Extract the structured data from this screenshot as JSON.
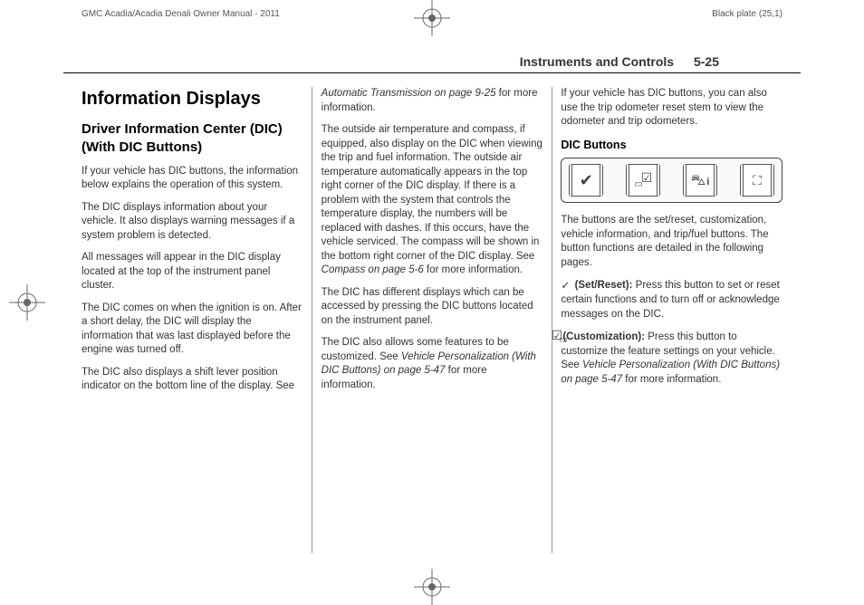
{
  "meta": {
    "manual_title": "GMC Acadia/Acadia Denali Owner Manual - 2011",
    "plate": "Black plate (25,1)"
  },
  "header": {
    "section": "Instruments and Controls",
    "page": "5-25"
  },
  "body": {
    "h1": "Information Displays",
    "h2": "Driver Information Center (DIC) (With DIC Buttons)",
    "p1": "If your vehicle has DIC buttons, the information below explains the operation of this system.",
    "p2": "The DIC displays information about your vehicle. It also displays warning messages if a system problem is detected.",
    "p3": "All messages will appear in the DIC display located at the top of the instrument panel cluster.",
    "p4": "The DIC comes on when the ignition is on. After a short delay, the DIC will display the information that was last displayed before the engine was turned off.",
    "p5a": "The DIC also displays a shift lever position indicator on the bottom line of the display. See ",
    "p5b": "Automatic Transmission on page 9-25",
    "p5c": " for more information.",
    "p6a": "The outside air temperature and compass, if equipped, also display on the DIC when viewing the trip and fuel information. The outside air temperature automatically appears in the top right corner of the DIC display. If there is a problem with the system that controls the temperature display, the numbers will be replaced with dashes. If this occurs, have the vehicle serviced. The compass will be shown in the bottom right corner of the DIC display. See ",
    "p6b": "Compass on page 5-6",
    "p6c": " for more information.",
    "p7": "The DIC has different displays which can be accessed by pressing the DIC buttons located on the instrument panel.",
    "p8a": "The DIC also allows some features to be customized. See ",
    "p8b": "Vehicle Personalization (With DIC Buttons) on page 5-47",
    "p8c": " for more information.",
    "p9": "If your vehicle has DIC buttons, you can also use the trip odometer reset stem to view the odometer and trip odometers.",
    "h3": "DIC Buttons",
    "p10": "The buttons are the set/reset, customization, vehicle information, and trip/fuel buttons. The button functions are detailed in the following pages.",
    "p11_icon": "✓",
    "p11_label": " (Set/Reset): ",
    "p11_text": "Press this button to set or reset certain functions and to turn off or acknowledge messages on the DIC.",
    "p12_label": " (Customization): ",
    "p12_texta": "Press this button to customize the feature settings on your vehicle. See ",
    "p12_textb": "Vehicle Personalization (With DIC Buttons) on page 5-47",
    "p12_textc": " for more information."
  }
}
